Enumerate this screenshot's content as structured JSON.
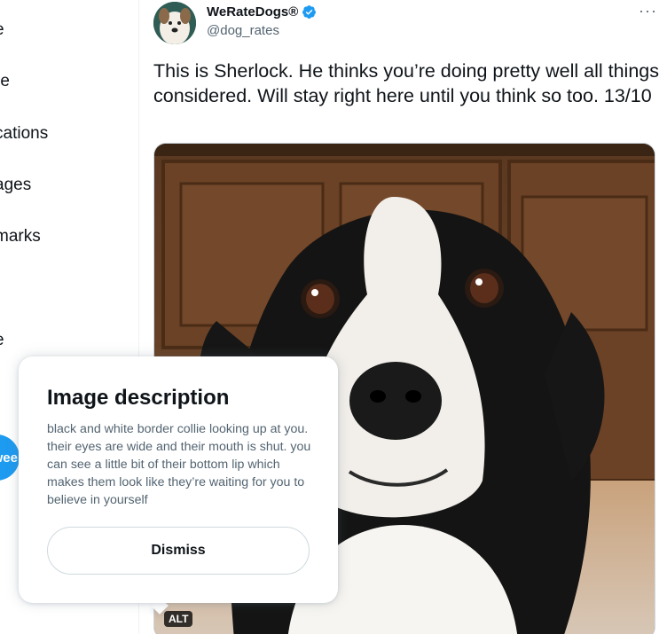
{
  "sidebar": {
    "items": [
      {
        "label": "e"
      },
      {
        "label": "re"
      },
      {
        "label": "cations"
      },
      {
        "label": "ages"
      },
      {
        "label": "marks"
      },
      {
        "label": "e"
      }
    ],
    "tweet_button": "wee"
  },
  "tweet": {
    "author_name": "WeRateDogs®",
    "handle": "@dog_rates",
    "more_icon": "more-icon",
    "verified_icon": "verified-badge-icon",
    "text": "This is Sherlock. He thinks you’re doing pretty well all things considered. Will stay right here until you think so too. 13/10",
    "alt_badge": "ALT"
  },
  "popover": {
    "title": "Image description",
    "body": "black and white border collie looking up at you. their eyes are wide and their mouth is shut. you can see a little bit of their bottom lip which makes them look like they’re waiting for you to believe in yourself",
    "dismiss_label": "Dismiss"
  },
  "colors": {
    "accent": "#1d9bf0",
    "text_primary": "#0f1419",
    "text_secondary": "#536471"
  }
}
